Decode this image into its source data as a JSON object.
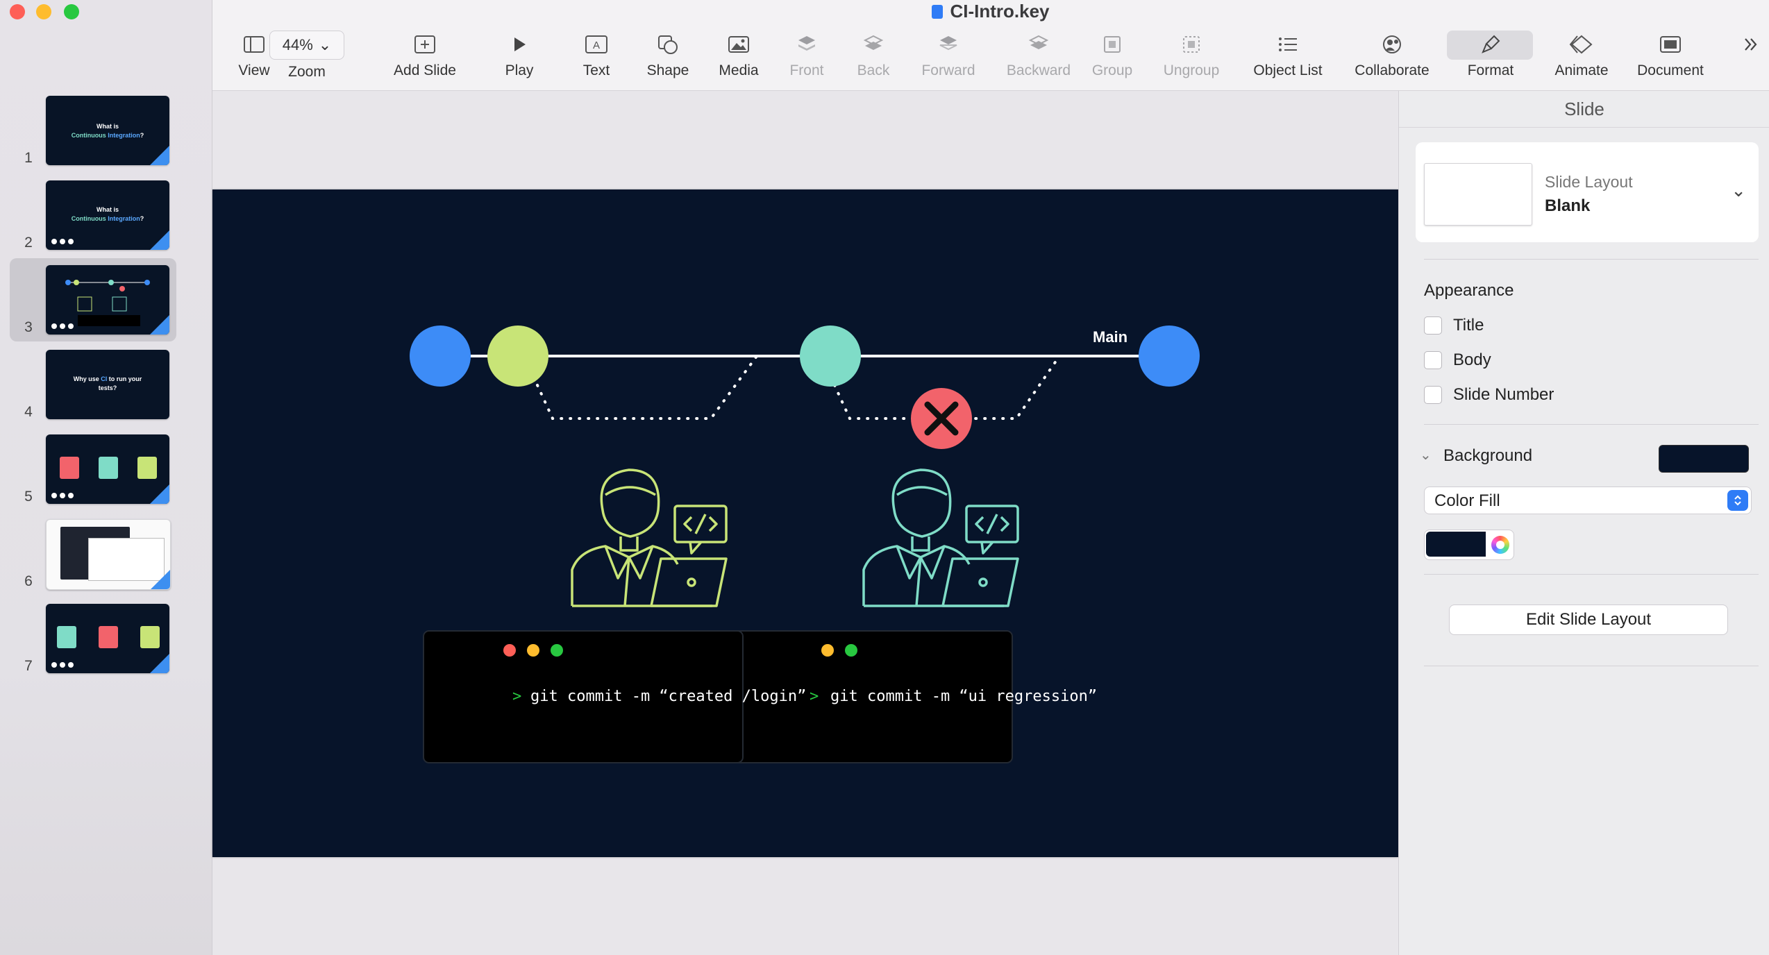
{
  "window": {
    "title": "CI-Intro.key"
  },
  "toolbar": {
    "view": "View",
    "zoom": "Zoom",
    "zoom_value": "44%",
    "add_slide": "Add Slide",
    "play": "Play",
    "text": "Text",
    "shape": "Shape",
    "media": "Media",
    "front": "Front",
    "back": "Back",
    "forward": "Forward",
    "backward": "Backward",
    "group": "Group",
    "ungroup": "Ungroup",
    "object_list": "Object List",
    "collaborate": "Collaborate",
    "format": "Format",
    "animate": "Animate",
    "document": "Document"
  },
  "navigator": {
    "slides": [
      {
        "number": "1",
        "line1": "What is",
        "line2a": "Continuous ",
        "line2b": "Integration",
        "line2c": "?"
      },
      {
        "number": "2",
        "line1": "What is",
        "line2a": "Continuous ",
        "line2b": "Integration",
        "line2c": "?"
      },
      {
        "number": "3"
      },
      {
        "number": "4",
        "line1a": "Why use ",
        "line1b": "CI",
        "line1c": " to run your",
        "line2": "tests?"
      },
      {
        "number": "5"
      },
      {
        "number": "6"
      },
      {
        "number": "7"
      }
    ],
    "selected": 3
  },
  "slide": {
    "branch_label": "Main",
    "terminal_left_cmd": "git commit -m “created /login”",
    "terminal_right_cmd": "git commit -m “ui regression”",
    "prompt": ">",
    "colors": {
      "background": "#07142a",
      "blue": "#3d8cf7",
      "lime": "#c8e477",
      "teal": "#7fdcc7",
      "red": "#f2636b"
    }
  },
  "inspector": {
    "tab": "Slide",
    "layout_label": "Slide Layout",
    "layout_value": "Blank",
    "appearance": "Appearance",
    "title": "Title",
    "body": "Body",
    "slide_number": "Slide Number",
    "background": "Background",
    "fill_type": "Color Fill",
    "edit_layout": "Edit Slide Layout",
    "bg_color": "#07142a"
  }
}
